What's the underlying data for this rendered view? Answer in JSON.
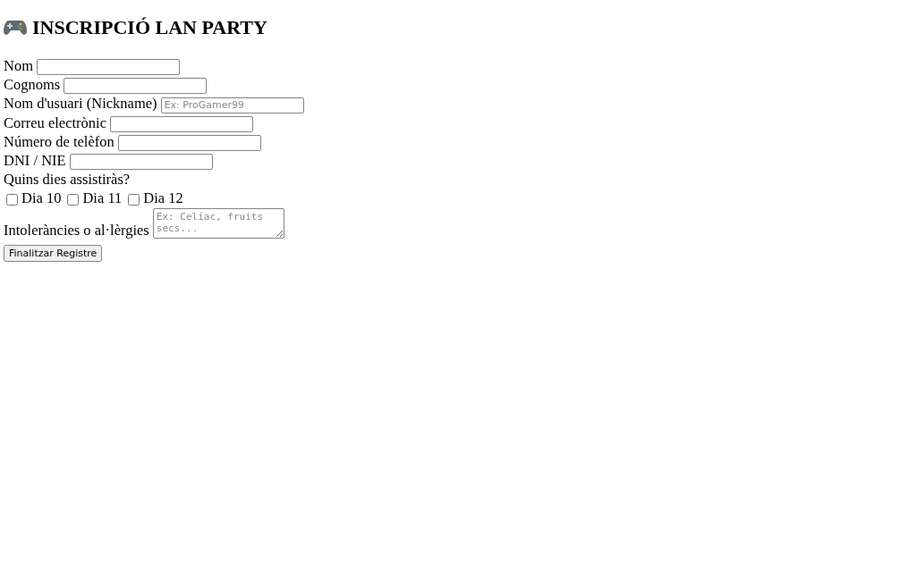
{
  "heading": {
    "title": "INSCRIPCIÓ LAN PARTY"
  },
  "fields": [
    {
      "kind": "text",
      "label": "Nom"
    },
    {
      "kind": "text",
      "label": "Cognoms"
    },
    {
      "kind": "text",
      "label": "Nom d'usuari (Nickname)",
      "placeholder": "Ex: ProGamer99"
    },
    {
      "kind": "text",
      "label": "Correu electrònic"
    },
    {
      "kind": "text",
      "label": "Número de telèfon"
    },
    {
      "kind": "text",
      "label": "DNI / NIE"
    }
  ],
  "days": {
    "question": "Quins dies assistiràs?",
    "options": [
      {
        "label": "Dia 10",
        "checked": false
      },
      {
        "label": "Dia 11",
        "checked": false
      },
      {
        "label": "Dia 12",
        "checked": false
      }
    ]
  },
  "allergies": {
    "label": "Intoleràncies o al·lèrgies",
    "placeholder": "Ex: Celíac, fruits secs..."
  },
  "submit_button": {
    "label": "Finalitzar Registre"
  }
}
